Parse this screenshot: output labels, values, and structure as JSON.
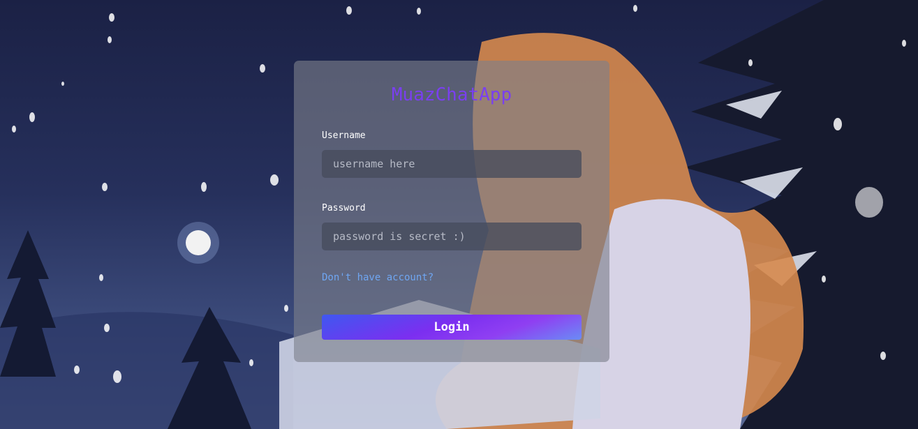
{
  "app": {
    "title": "MuazChatApp"
  },
  "form": {
    "username_label": "Username",
    "username_placeholder": "username here",
    "username_value": "",
    "password_label": "Password",
    "password_placeholder": "password is secret :)",
    "password_value": "",
    "register_link": "Don't have account?",
    "login_button": "Login"
  },
  "colors": {
    "title": "#7a3ff0",
    "link": "#6fa6f2",
    "button_gradient_start": "#3f58f0",
    "button_gradient_mid": "#8f3ff2"
  },
  "background": {
    "scene": "night-snow-illustration"
  }
}
